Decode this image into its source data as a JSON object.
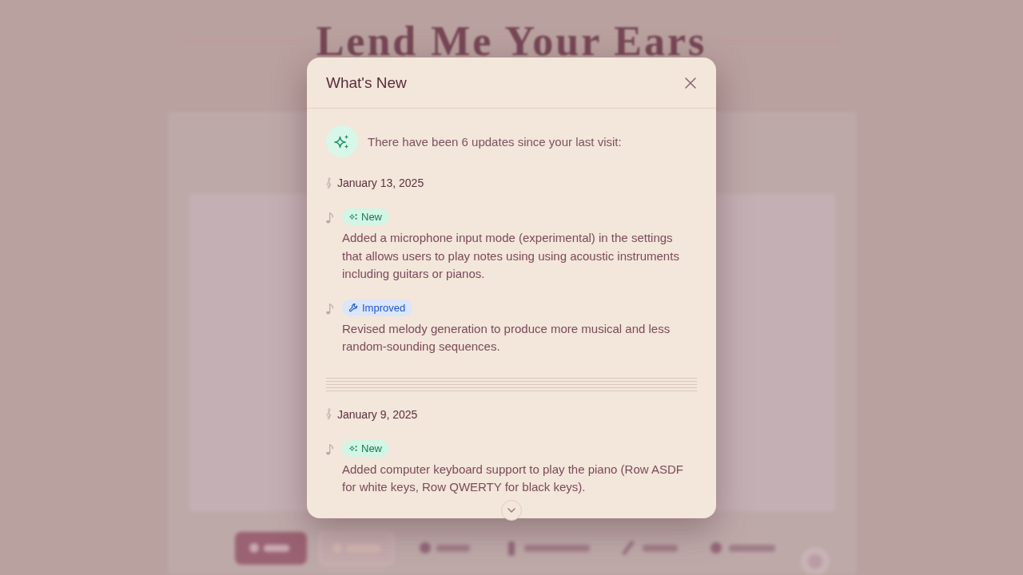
{
  "background": {
    "title": "Lend Me Your Ears"
  },
  "dialog": {
    "title": "What's New",
    "intro": "There have been 6 updates since your last visit:",
    "groups": [
      {
        "date": "January 13, 2025",
        "entries": [
          {
            "kind": "new",
            "badge": "New",
            "text": "Added a microphone input mode (experimental) in the settings that allows users to play notes using using acoustic instruments including guitars or pianos."
          },
          {
            "kind": "improved",
            "badge": "Improved",
            "text": "Revised melody generation to produce more musical and less random-sounding sequences."
          }
        ]
      },
      {
        "date": "January 9, 2025",
        "entries": [
          {
            "kind": "new",
            "badge": "New",
            "text": "Added computer keyboard support to play the piano (Row ASDF for white keys, Row QWERTY for black keys)."
          }
        ]
      }
    ]
  }
}
